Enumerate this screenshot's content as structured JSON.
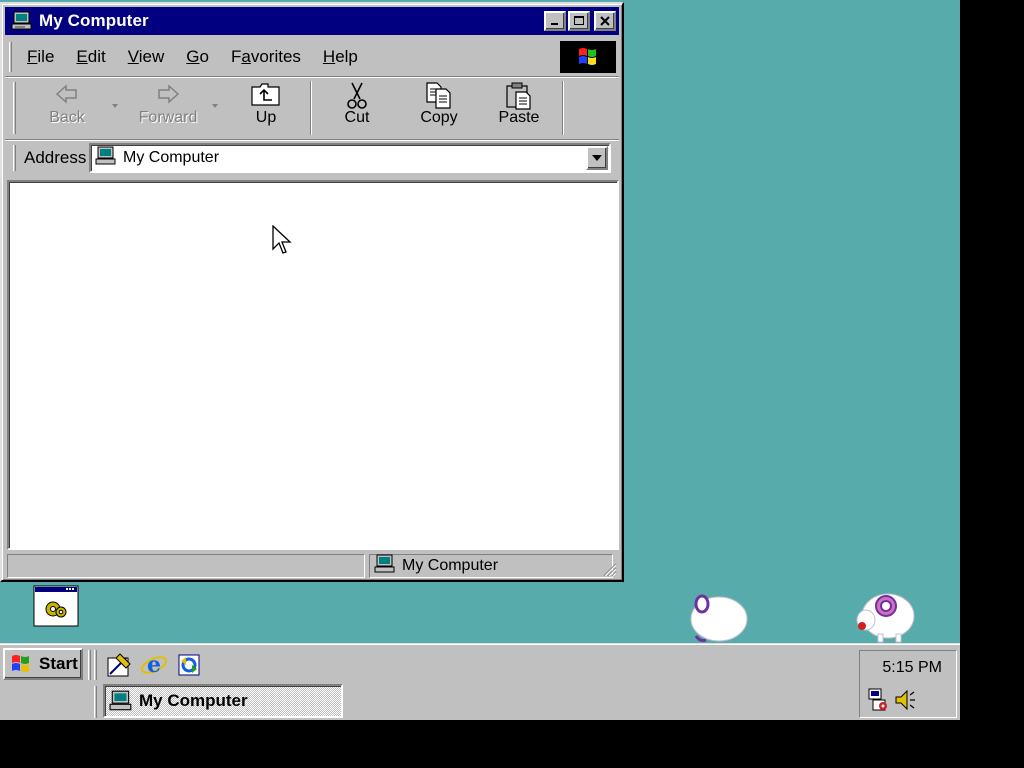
{
  "window": {
    "title": "My Computer",
    "menu": [
      "File",
      "Edit",
      "View",
      "Go",
      "Favorites",
      "Help"
    ],
    "menu_underline": [
      "F",
      "E",
      "V",
      "G",
      "a",
      "H"
    ],
    "toolbar": {
      "back": "Back",
      "forward": "Forward",
      "up": "Up",
      "cut": "Cut",
      "copy": "Copy",
      "paste": "Paste"
    },
    "address": {
      "label": "Address",
      "value": "My Computer"
    },
    "status": {
      "left": "",
      "right": "My Computer"
    }
  },
  "taskbar": {
    "start_label": "Start",
    "task_label": "My Computer",
    "clock": "5:15 PM"
  },
  "icons": {
    "title": "computer-icon",
    "logo": "windows-logo-icon",
    "back": "back-arrow-icon",
    "forward": "forward-arrow-icon",
    "up": "up-folder-icon",
    "cut": "scissors-icon",
    "copy": "copy-icon",
    "paste": "clipboard-icon",
    "quicklaunch": [
      "show-desktop-icon",
      "internet-explorer-icon",
      "channels-icon"
    ],
    "tray": [
      "network-icon",
      "volume-icon"
    ]
  },
  "colors": {
    "desktop": "#58ABAB",
    "titlebar": "#000080",
    "face": "#C0C0C0"
  }
}
